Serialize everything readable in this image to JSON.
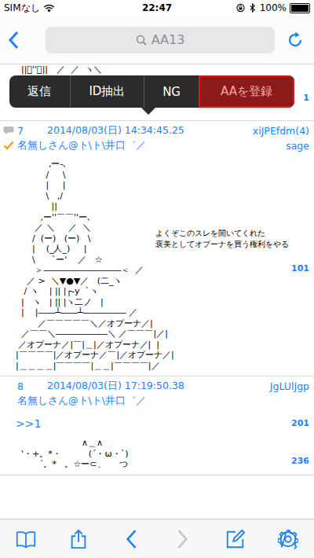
{
  "status_bar": {
    "carrier": "SIMなし",
    "time": "22:47",
    "battery": "100%",
    "battery_level": 1.0
  },
  "nav_bar": {
    "search": {
      "placeholder": "AA13"
    }
  },
  "context_menu": {
    "items": [
      {
        "label": "返信",
        "selected": false
      },
      {
        "label": "ID抽出",
        "selected": false
      },
      {
        "label": "NG",
        "selected": false
      },
      {
        "label": "AAを登録",
        "selected": true
      }
    ]
  },
  "gutter_marks": [
    "1",
    "101",
    "201",
    "236"
  ],
  "top_post": {
    "aa_lines": [
      "  ||ﾞ''ﾞ||   ／  ／  ヽ＼"
    ]
  },
  "posts": [
    {
      "number": "7",
      "has_replies": true,
      "date": "2014/08/03(日) 14:34:45.25",
      "id": "xiJPEfdm(4)",
      "checked": true,
      "name": "名無しさん@ト\\ト\\井口゛／",
      "mail": "sage",
      "reply_links": [],
      "caption": [
        "よくぞこのスレを開いてくれた",
        "褒美としてオプーナを買う権利をやる"
      ],
      "aa_lines": [
        "            ,ー‐､",
        "           /     \\",
        "           |     |",
        "           \\   ,/",
        "             ||",
        "         ,ー''￣￣''ー､",
        "       ／ ＼     ／  ＼",
        "      /  (ー)   (ー)   \\",
        "      |    (_人_)     |",
        "      \\      `ー'    ／   ☆",
        "       ＞―――――――――＜  ／",
        "    ／ >  ＼▼●▼／   (二_ヽ",
        "   / ヽ    | || |┌-y  `ヽ",
        "  |   ヽ   | || |ヽ二ノ   |",
        "  |    |――┴――┴――――― ／",
        "        ／￣￣￣￣￣＼／オプーナ／|",
        "  ／￣￣＼――――――＼ ／￣￣￣|／|",
        " ／オプーナ／|￣|＿|／オプーナ／|  |",
        "|￣￣￣￣|／オプーナ／￣|／オプーナ／|",
        "|＿＿＿＿|￣￣￣￣|＿＿|￣￣￣￣|／"
      ]
    },
    {
      "number": "8",
      "has_replies": false,
      "date": "2014/08/03(日) 17:19:50.38",
      "id": "JgLUlJgp",
      "checked": false,
      "name": "名無しさん@ト\\ト\\井口゛／",
      "mail": "",
      "reply_links": [
        ">>1"
      ],
      "caption": [],
      "aa_lines": [
        "                        ∧＿∧",
        "  '・+。*・          (´・ω・`)",
        "       ゜。*   。☆ー⊂、     つ"
      ]
    }
  ],
  "toolbar": {
    "items": [
      {
        "kind": "bookmarks",
        "disabled": false
      },
      {
        "kind": "share",
        "disabled": false
      },
      {
        "kind": "back",
        "disabled": false
      },
      {
        "kind": "forward",
        "disabled": true
      },
      {
        "kind": "compose",
        "disabled": false
      },
      {
        "kind": "settings",
        "disabled": false
      }
    ]
  }
}
